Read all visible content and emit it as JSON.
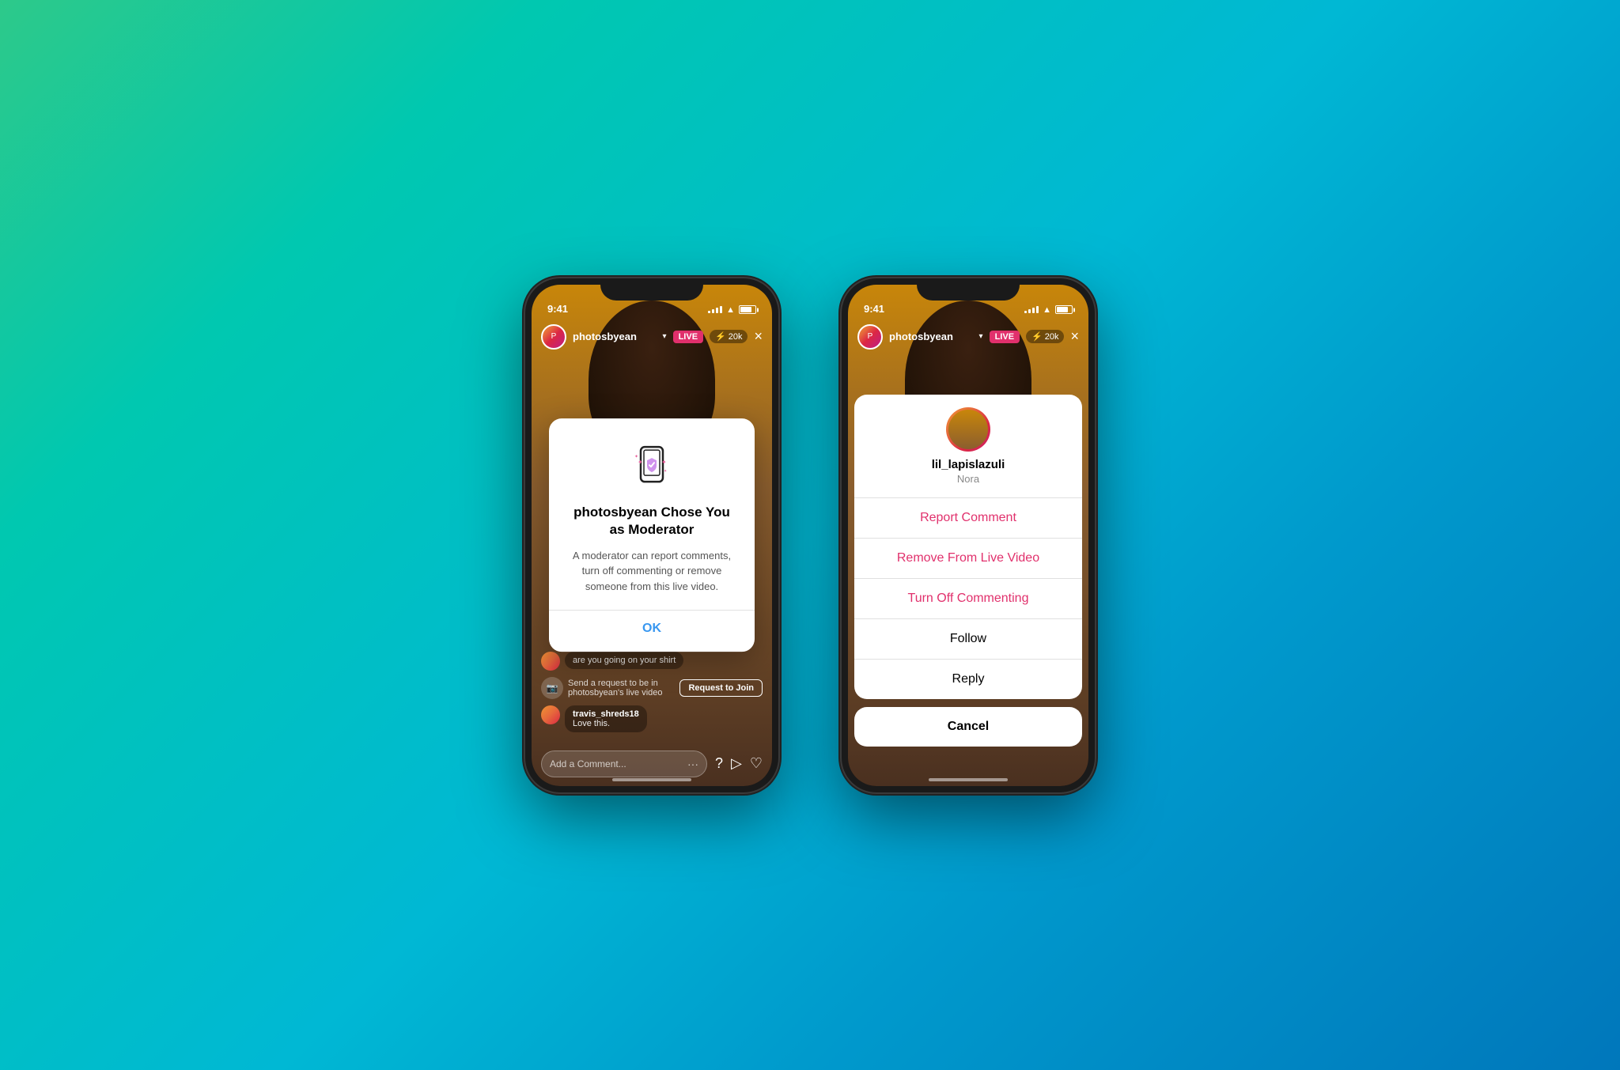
{
  "background": {
    "gradient_start": "#2dc98a",
    "gradient_end": "#0077bb"
  },
  "phone1": {
    "status_bar": {
      "time": "9:41",
      "battery_label": "battery"
    },
    "topbar": {
      "username": "photosbyean",
      "live_label": "LIVE",
      "viewers": "20k",
      "close_label": "×"
    },
    "comments": [
      {
        "text": "are you going on your shirt"
      },
      {
        "text": "Love this.",
        "username": "travis_shreds18"
      }
    ],
    "request_join": {
      "text": "Send a request to be in photosbyean's live video",
      "button_label": "Request to Join"
    },
    "comment_input_placeholder": "Add a Comment...",
    "modal": {
      "title": "photosbyean Chose You as Moderator",
      "body": "A moderator can report comments, turn off commenting or remove someone from this live video.",
      "ok_label": "OK"
    }
  },
  "phone2": {
    "status_bar": {
      "time": "9:41"
    },
    "topbar": {
      "username": "photosbyean",
      "live_label": "LIVE",
      "viewers": "20k",
      "close_label": "×"
    },
    "action_sheet": {
      "username": "lil_lapislazuli",
      "real_name": "Nora",
      "items": [
        {
          "label": "Report Comment",
          "color": "red"
        },
        {
          "label": "Remove From Live Video",
          "color": "red"
        },
        {
          "label": "Turn Off Commenting",
          "color": "red"
        },
        {
          "label": "Follow",
          "color": "black"
        },
        {
          "label": "Reply",
          "color": "black"
        }
      ],
      "cancel_label": "Cancel"
    }
  }
}
